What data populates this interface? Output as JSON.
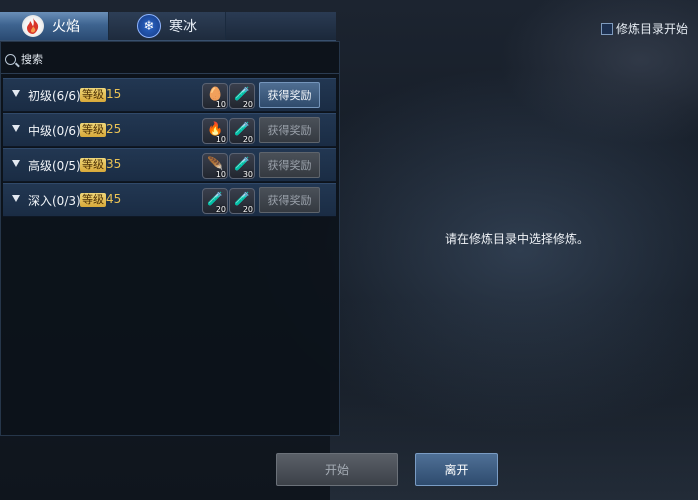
{
  "tabs": [
    {
      "label": "火焰",
      "icon": "flame-icon"
    },
    {
      "label": "寒冰",
      "icon": "snowflake-icon"
    }
  ],
  "checkbox_label": "修炼目录开始",
  "search_placeholder": "搜索",
  "level_word": "等级",
  "rows": [
    {
      "name": "初级(6/6)",
      "level": "15",
      "items": [
        {
          "icon": "egg-icon",
          "qty": "10"
        },
        {
          "icon": "potion-icon",
          "qty": "20"
        }
      ],
      "button": "获得奖励",
      "enabled": true
    },
    {
      "name": "中级(0/6)",
      "level": "25",
      "items": [
        {
          "icon": "fire-orb-icon",
          "qty": "10"
        },
        {
          "icon": "potion-icon",
          "qty": "20"
        }
      ],
      "button": "获得奖励",
      "enabled": false
    },
    {
      "name": "高级(0/5)",
      "level": "35",
      "items": [
        {
          "icon": "feather-icon",
          "qty": "10"
        },
        {
          "icon": "potion-icon",
          "qty": "30"
        }
      ],
      "button": "获得奖励",
      "enabled": false
    },
    {
      "name": "深入(0/3)",
      "level": "45",
      "items": [
        {
          "icon": "potion-icon",
          "qty": "20"
        },
        {
          "icon": "potion-icon",
          "qty": "20"
        }
      ],
      "button": "获得奖励",
      "enabled": false
    }
  ],
  "message": "请在修炼目录中选择修炼。",
  "buttons": {
    "start": "开始",
    "leave": "离开"
  }
}
